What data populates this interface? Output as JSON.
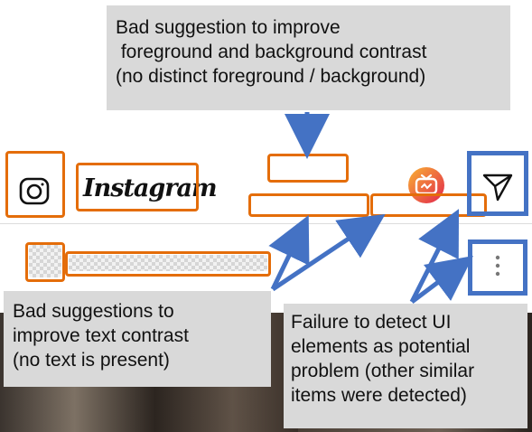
{
  "app": {
    "logo_text": "Instagram"
  },
  "callouts": {
    "top": [
      "Bad suggestion to improve",
      " foreground and background contrast",
      "(no distinct foreground / background)"
    ],
    "left": [
      "Bad suggestions to",
      "improve text contrast",
      "(no text is present)"
    ],
    "right": [
      "Failure to detect UI",
      "elements as potential",
      "problem (other similar",
      "items were detected)"
    ]
  },
  "colors": {
    "suggestion_box": "#e46d0a",
    "missed_box": "#4472c4",
    "callout_bg": "#d9d9d9",
    "igtv_gradient": [
      "#f9b233",
      "#e2264d"
    ]
  },
  "icons": {
    "camera": "camera-icon",
    "igtv": "igtv-icon",
    "direct": "paper-plane-icon",
    "more": "vertical-dots-icon"
  }
}
